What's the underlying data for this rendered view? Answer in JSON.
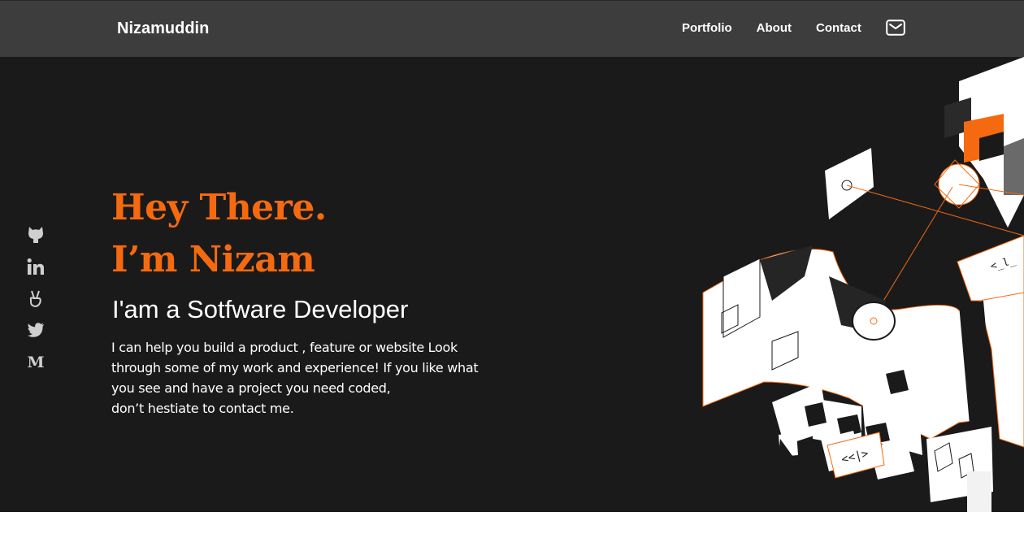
{
  "header": {
    "brand": "Nizamuddin",
    "nav": [
      {
        "label": "Portfolio"
      },
      {
        "label": "About"
      },
      {
        "label": "Contact"
      }
    ],
    "mail_icon": "mail-icon"
  },
  "socials": [
    {
      "icon": "github-icon"
    },
    {
      "icon": "linkedin-icon"
    },
    {
      "icon": "angellist-icon"
    },
    {
      "icon": "twitter-icon"
    },
    {
      "icon": "medium-icon"
    }
  ],
  "hero": {
    "line1": "Hey There.",
    "line2": "I’m Nizam",
    "role": "I'am a Sotfware Developer",
    "intro": [
      "I can help you build a product , feature or website Look",
      "through some of my work and experience! If you like what",
      "you see and have a project you need coded,",
      "don’t hestiate to contact me."
    ]
  },
  "colors": {
    "accent": "#f56a10",
    "navbar": "#3e3d3d",
    "background": "#1b1a1a",
    "text": "#ffffff"
  }
}
